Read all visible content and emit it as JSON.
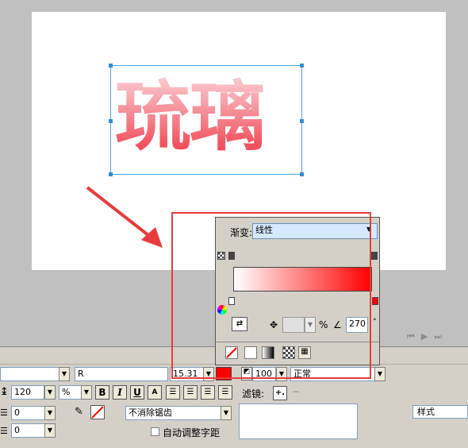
{
  "canvas": {
    "text_object": "琉璃"
  },
  "gradient_panel": {
    "type_label": "渐变:",
    "type_value": "线性",
    "percent_label": "%",
    "angle_value": "270",
    "colors": {
      "start": "#ffffff",
      "end": "#ff0000"
    }
  },
  "props": {
    "font_name_partial": "R",
    "font_size_partial": "15.31",
    "color_swatch": "#ff0000",
    "opacity_value": "100",
    "blend_mode": "正常",
    "line_height": "120",
    "line_height_unit": "%",
    "bold": "B",
    "italic": "I",
    "underline": "U",
    "indent_value": "0",
    "spacing_value": "0",
    "antialias": "不消除锯齿",
    "filters_label": "滤镜:",
    "filters_add": "+.",
    "auto_kern_label": "自动调整字距",
    "styles_label": "样式"
  },
  "accent_colors": {
    "annotation_red": "#e83b3b",
    "selection_blue": "#4aa3df"
  }
}
